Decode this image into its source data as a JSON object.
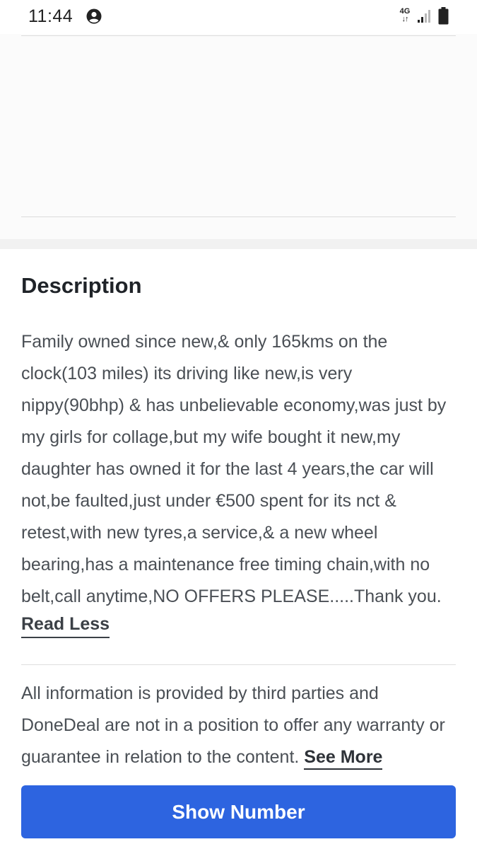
{
  "status_bar": {
    "time": "11:44",
    "network": "4G",
    "icons": [
      "account-circle-icon",
      "network-4g-icon",
      "signal-icon",
      "battery-icon"
    ]
  },
  "description": {
    "title": "Description",
    "text": "Family owned since new,& only 165kms on the clock(103 miles) its driving like new,is very nippy(90bhp) & has unbelievable economy,was just by my girls for collage,but my wife bought it new,my daughter has owned it for the last 4 years,the car will not,be faulted,just under €500 spent for its nct & retest,with new tyres,a service,& a new wheel bearing,has a maintenance free timing chain,with no belt,call anytime,NO OFFERS PLEASE.....Thank you.",
    "read_less_label": "Read Less"
  },
  "disclaimer": {
    "text": "All information is provided by third parties and DoneDeal are not in a position to offer any warranty or guarantee in relation to the content.",
    "see_more_label": "See More"
  },
  "cta": {
    "show_number_label": "Show Number",
    "color": "#2d64e0"
  }
}
